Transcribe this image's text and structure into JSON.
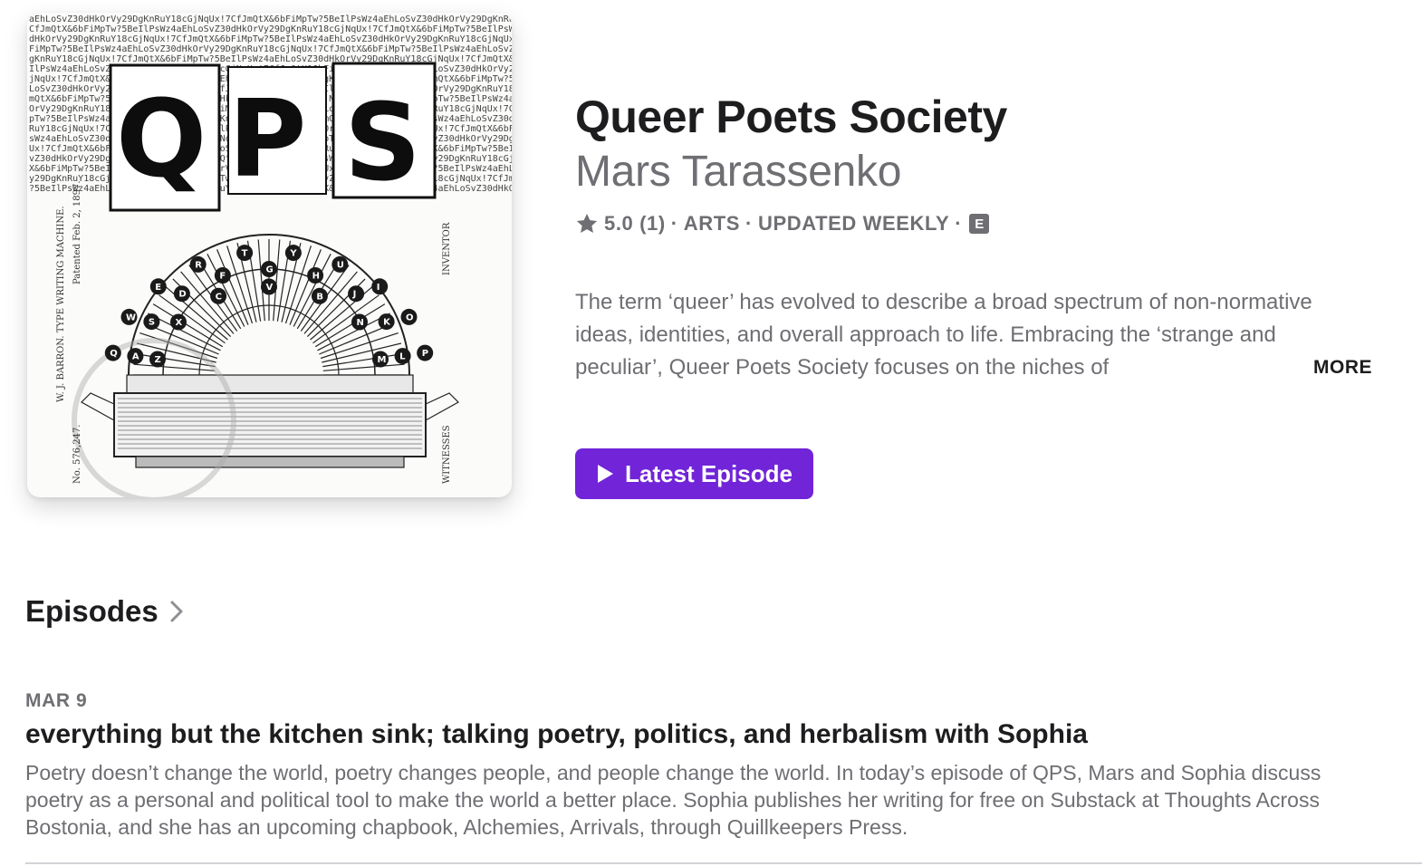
{
  "artwork": {
    "letters": [
      "Q",
      "P",
      "S"
    ],
    "key_letters": [
      "Q",
      "W",
      "E",
      "R",
      "T",
      "Y",
      "U",
      "I",
      "O",
      "P",
      "A",
      "S",
      "D",
      "F",
      "G",
      "H",
      "J",
      "K",
      "L",
      "Z",
      "X",
      "C",
      "V",
      "B",
      "N",
      "M"
    ]
  },
  "podcast": {
    "title": "Queer Poets Society",
    "author": "Mars Tarassenko",
    "rating": "5.0 (1)",
    "category": "ARTS",
    "frequency": "UPDATED WEEKLY",
    "explicit_badge": "E",
    "description": "The term ‘queer’ has evolved to describe a broad spectrum of non-normative ideas, identities, and overall approach to life. Embracing the ‘strange and peculiar’, Queer Poets Society focuses on the niches of",
    "more_label": "MORE",
    "latest_episode_label": "Latest Episode"
  },
  "episodes": {
    "header": "Episodes",
    "items": [
      {
        "date": "MAR 9",
        "title": "everything but the kitchen sink; talking poetry, politics, and herbalism with Sophia",
        "summary": "Poetry doesn’t change the world, poetry changes people, and people change the world. In today’s episode of QPS, Mars and Sophia discuss poetry as a personal and political tool to make the world a better place. Sophia publishes her writing for free on Substack at Thoughts Across Bostonia, and she has an upcoming chapbook, Alchemies, Arrivals, through Quillkeepers Press."
      }
    ]
  },
  "colors": {
    "accent": "#7124d8",
    "primary_text": "#1d1d1f",
    "secondary_text": "#6e6e73"
  }
}
